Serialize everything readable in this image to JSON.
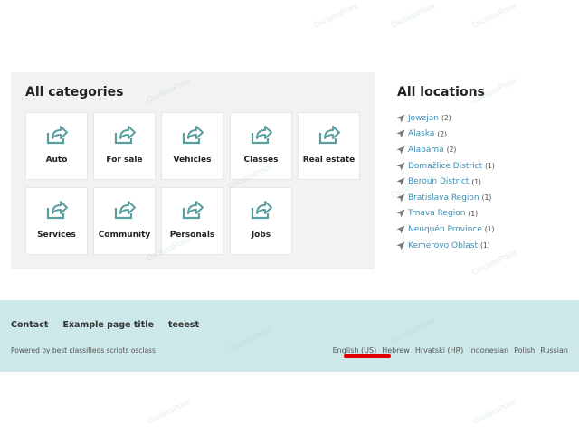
{
  "categories": {
    "title": "All categories",
    "items": [
      {
        "label": "Auto"
      },
      {
        "label": "For sale"
      },
      {
        "label": "Vehicles"
      },
      {
        "label": "Classes"
      },
      {
        "label": "Real estate"
      },
      {
        "label": "Services"
      },
      {
        "label": "Community"
      },
      {
        "label": "Personals"
      },
      {
        "label": "Jobs"
      }
    ],
    "icon": "share-arrow-icon",
    "icon_color": "#5a9ea0"
  },
  "locations": {
    "title": "All locations",
    "icon": "location-arrow-icon",
    "items": [
      {
        "name": "Jowzjan",
        "count": "(2)"
      },
      {
        "name": "Alaska",
        "count": "(2)"
      },
      {
        "name": "Alabama",
        "count": "(2)"
      },
      {
        "name": "Domažlice District",
        "count": "(1)"
      },
      {
        "name": "Beroun District",
        "count": "(1)"
      },
      {
        "name": "Bratislava Region",
        "count": "(1)"
      },
      {
        "name": "Trnava Region",
        "count": "(1)"
      },
      {
        "name": "Neuquén Province",
        "count": "(1)"
      },
      {
        "name": "Kemerovo Oblast",
        "count": "(1)"
      }
    ],
    "link_color": "#3a8fb7"
  },
  "footer": {
    "links": [
      "Contact",
      "Example page title",
      "teeest"
    ],
    "powered_by": "Powered by best classifieds scripts osclass",
    "languages": [
      "English (US)",
      "Hebrew",
      "Hrvatski (HR)",
      "Indonesian",
      "Polish",
      "Russian"
    ],
    "background": "#cde8e8",
    "highlight_color": "#e00000"
  },
  "watermark": "OsclassPoint"
}
